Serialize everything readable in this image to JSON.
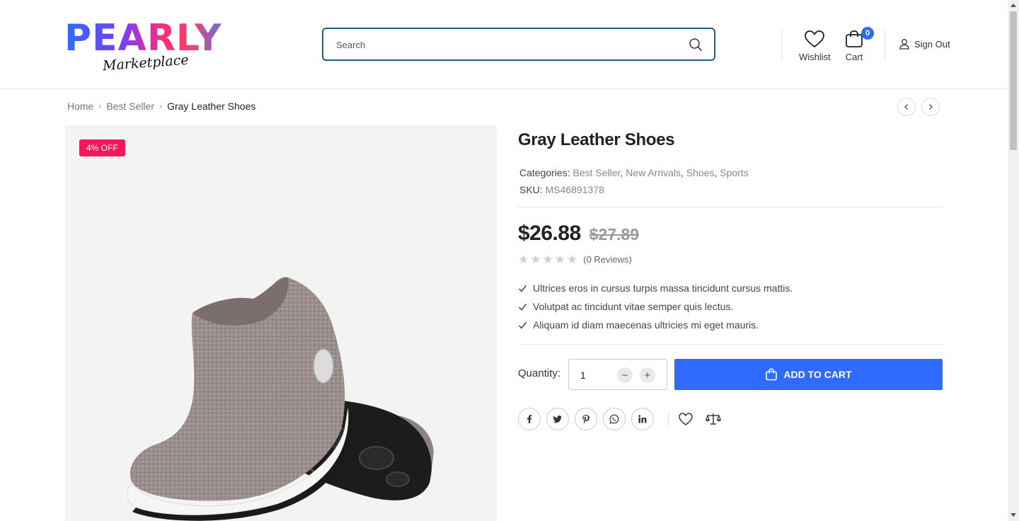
{
  "header": {
    "logo_text": "PEARLY",
    "logo_subtext": "Marketplace",
    "search_placeholder": "Search",
    "wishlist_label": "Wishlist",
    "cart_label": "Cart",
    "cart_count": "0",
    "signout_label": "Sign Out"
  },
  "breadcrumb": {
    "items": [
      "Home",
      "Best Seller",
      "Gray Leather Shoes"
    ]
  },
  "product": {
    "discount_badge": "4% OFF",
    "title": "Gray Leather Shoes",
    "categories_label": "Categories:",
    "categories": [
      "Best Seller",
      "New Arrivals",
      "Shoes",
      "Sports"
    ],
    "sku_label": "SKU:",
    "sku": "MS46891378",
    "price": "$26.88",
    "old_price": "$27.89",
    "rating": 0,
    "reviews": "(0 Reviews)",
    "features": [
      "Ultrices eros in cursus turpis massa tincidunt cursus mattis.",
      "Volutpat ac tincidunt vitae semper quis lectus.",
      "Aliquam id diam maecenas ultricies mi eget mauris."
    ],
    "quantity_label": "Quantity:",
    "quantity": "1",
    "add_to_cart": "ADD TO CART"
  },
  "social": [
    "facebook-icon",
    "twitter-icon",
    "pinterest-icon",
    "whatsapp-icon",
    "linkedin-icon"
  ],
  "colors": {
    "accent": "#2f6bff",
    "badge": "#f4175a",
    "search_border": "#1f5c8b"
  }
}
